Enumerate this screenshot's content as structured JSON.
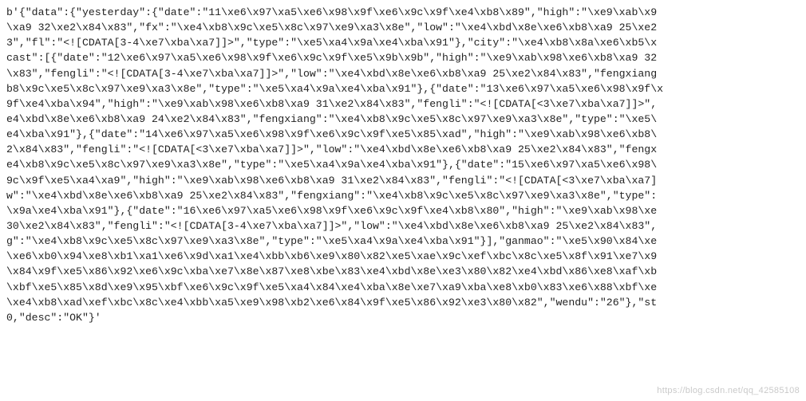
{
  "lines": [
    "b'{\"data\":{\"yesterday\":{\"date\":\"11\\xe6\\x97\\xa5\\xe6\\x98\\x9f\\xe6\\x9c\\x9f\\xe4\\xb8\\x89\",\"high\":\"\\xe9\\xab\\x9",
    "\\xa9 32\\xe2\\x84\\x83\",\"fx\":\"\\xe4\\xb8\\x9c\\xe5\\x8c\\x97\\xe9\\xa3\\x8e\",\"low\":\"\\xe4\\xbd\\x8e\\xe6\\xb8\\xa9 25\\xe2",
    "3\",\"fl\":\"<![CDATA[3-4\\xe7\\xba\\xa7]]>\",\"type\":\"\\xe5\\xa4\\x9a\\xe4\\xba\\x91\"},\"city\":\"\\xe4\\xb8\\x8a\\xe6\\xb5\\x",
    "cast\":[{\"date\":\"12\\xe6\\x97\\xa5\\xe6\\x98\\x9f\\xe6\\x9c\\x9f\\xe5\\x9b\\x9b\",\"high\":\"\\xe9\\xab\\x98\\xe6\\xb8\\xa9 32",
    "\\x83\",\"fengli\":\"<![CDATA[3-4\\xe7\\xba\\xa7]]>\",\"low\":\"\\xe4\\xbd\\x8e\\xe6\\xb8\\xa9 25\\xe2\\x84\\x83\",\"fengxiang",
    "b8\\x9c\\xe5\\x8c\\x97\\xe9\\xa3\\x8e\",\"type\":\"\\xe5\\xa4\\x9a\\xe4\\xba\\x91\"},{\"date\":\"13\\xe6\\x97\\xa5\\xe6\\x98\\x9f\\x",
    "9f\\xe4\\xba\\x94\",\"high\":\"\\xe9\\xab\\x98\\xe6\\xb8\\xa9 31\\xe2\\x84\\x83\",\"fengli\":\"<![CDATA[<3\\xe7\\xba\\xa7]]>\",",
    "e4\\xbd\\x8e\\xe6\\xb8\\xa9 24\\xe2\\x84\\x83\",\"fengxiang\":\"\\xe4\\xb8\\x9c\\xe5\\x8c\\x97\\xe9\\xa3\\x8e\",\"type\":\"\\xe5\\",
    "e4\\xba\\x91\"},{\"date\":\"14\\xe6\\x97\\xa5\\xe6\\x98\\x9f\\xe6\\x9c\\x9f\\xe5\\x85\\xad\",\"high\":\"\\xe9\\xab\\x98\\xe6\\xb8\\",
    "2\\x84\\x83\",\"fengli\":\"<![CDATA[<3\\xe7\\xba\\xa7]]>\",\"low\":\"\\xe4\\xbd\\x8e\\xe6\\xb8\\xa9 25\\xe2\\x84\\x83\",\"fengx",
    "e4\\xb8\\x9c\\xe5\\x8c\\x97\\xe9\\xa3\\x8e\",\"type\":\"\\xe5\\xa4\\x9a\\xe4\\xba\\x91\"},{\"date\":\"15\\xe6\\x97\\xa5\\xe6\\x98\\",
    "9c\\x9f\\xe5\\xa4\\xa9\",\"high\":\"\\xe9\\xab\\x98\\xe6\\xb8\\xa9 31\\xe2\\x84\\x83\",\"fengli\":\"<![CDATA[<3\\xe7\\xba\\xa7]",
    "w\":\"\\xe4\\xbd\\x8e\\xe6\\xb8\\xa9 25\\xe2\\x84\\x83\",\"fengxiang\":\"\\xe4\\xb8\\x9c\\xe5\\x8c\\x97\\xe9\\xa3\\x8e\",\"type\":",
    "\\x9a\\xe4\\xba\\x91\"},{\"date\":\"16\\xe6\\x97\\xa5\\xe6\\x98\\x9f\\xe6\\x9c\\x9f\\xe4\\xb8\\x80\",\"high\":\"\\xe9\\xab\\x98\\xe",
    "30\\xe2\\x84\\x83\",\"fengli\":\"<![CDATA[3-4\\xe7\\xba\\xa7]]>\",\"low\":\"\\xe4\\xbd\\x8e\\xe6\\xb8\\xa9 25\\xe2\\x84\\x83\",",
    "g\":\"\\xe4\\xb8\\x9c\\xe5\\x8c\\x97\\xe9\\xa3\\x8e\",\"type\":\"\\xe5\\xa4\\x9a\\xe4\\xba\\x91\"}],\"ganmao\":\"\\xe5\\x90\\x84\\xe",
    "\\xe6\\xb0\\x94\\xe8\\xb1\\xa1\\xe6\\x9d\\xa1\\xe4\\xbb\\xb6\\xe9\\x80\\x82\\xe5\\xae\\x9c\\xef\\xbc\\x8c\\xe5\\x8f\\x91\\xe7\\x9",
    "\\x84\\x9f\\xe5\\x86\\x92\\xe6\\x9c\\xba\\xe7\\x8e\\x87\\xe8\\xbe\\x83\\xe4\\xbd\\x8e\\xe3\\x80\\x82\\xe4\\xbd\\x86\\xe8\\xaf\\xb",
    "\\xbf\\xe5\\x85\\x8d\\xe9\\x95\\xbf\\xe6\\x9c\\x9f\\xe5\\xa4\\x84\\xe4\\xba\\x8e\\xe7\\xa9\\xba\\xe8\\xb0\\x83\\xe6\\x88\\xbf\\xe",
    "\\xe4\\xb8\\xad\\xef\\xbc\\x8c\\xe4\\xbb\\xa5\\xe9\\x98\\xb2\\xe6\\x84\\x9f\\xe5\\x86\\x92\\xe3\\x80\\x82\",\"wendu\":\"26\"},\"st",
    "0,\"desc\":\"OK\"}'"
  ],
  "watermark": "https://blog.csdn.net/qq_42585108"
}
